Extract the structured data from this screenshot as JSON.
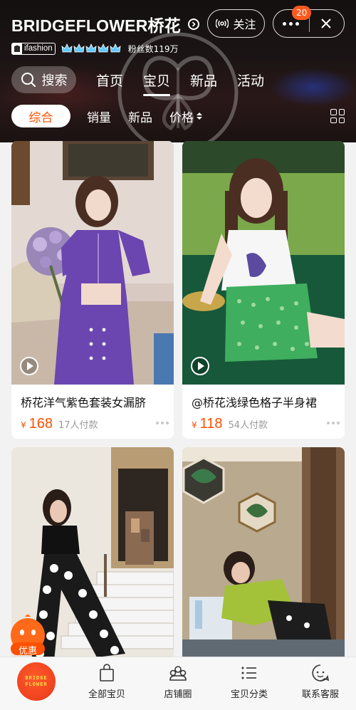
{
  "header": {
    "shop_name": "BRIDGEFLOWER桥花",
    "follow_label": "关注",
    "notification_count": "20",
    "ifashion_label": "ifashion",
    "fans_text": "粉丝数119万"
  },
  "nav": {
    "search_label": "搜索",
    "tabs": [
      {
        "label": "首页"
      },
      {
        "label": "宝贝"
      },
      {
        "label": "新品"
      },
      {
        "label": "活动"
      }
    ],
    "active_tab": "宝贝"
  },
  "filters": {
    "items": [
      {
        "label": "综合"
      },
      {
        "label": "销量"
      },
      {
        "label": "新品"
      },
      {
        "label": "价格"
      }
    ],
    "active": "综合"
  },
  "products": [
    {
      "title": "桥花洋气紫色套装女漏脐",
      "currency": "¥",
      "price": "168",
      "sold": "17人付款",
      "has_video": true
    },
    {
      "title": "@桥花浅绿色格子半身裙",
      "currency": "¥",
      "price": "118",
      "sold": "54人付款",
      "has_video": true
    },
    {
      "title": "",
      "currency": "",
      "price": "",
      "sold": "",
      "has_video": false
    },
    {
      "title": "",
      "currency": "",
      "price": "",
      "sold": "",
      "has_video": false
    }
  ],
  "coupon_label": "优惠",
  "bottom_bar": {
    "shop_logo_text": "BRIDGE FLOWER",
    "tabs": [
      {
        "label": "全部宝贝",
        "icon": "bag-icon"
      },
      {
        "label": "店铺圈",
        "icon": "community-icon"
      },
      {
        "label": "宝贝分类",
        "icon": "category-list-icon"
      },
      {
        "label": "联系客服",
        "icon": "customer-service-icon"
      }
    ]
  },
  "colors": {
    "accent": "#ff5000",
    "header_bg": "#141010",
    "badge": "#ff5a1f"
  }
}
